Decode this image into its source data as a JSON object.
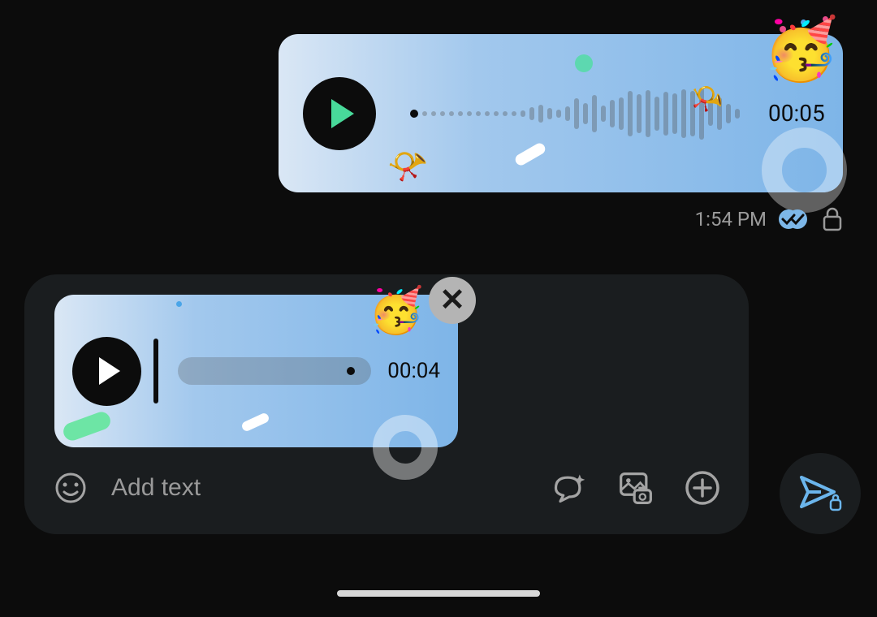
{
  "sent_message": {
    "duration": "00:05",
    "emoji": "🥳"
  },
  "meta": {
    "time": "1:54 PM"
  },
  "preview": {
    "duration": "00:04",
    "emoji": "🥳"
  },
  "composer": {
    "placeholder": "Add text"
  },
  "icons": {
    "emoji": "emoji-icon",
    "magic_reply": "magic-reply-icon",
    "gallery": "gallery-icon",
    "add": "add-icon",
    "send": "send-icon",
    "close": "close-icon",
    "play": "play-icon",
    "lock": "lock-icon",
    "read_receipt": "read-receipt-icon"
  }
}
